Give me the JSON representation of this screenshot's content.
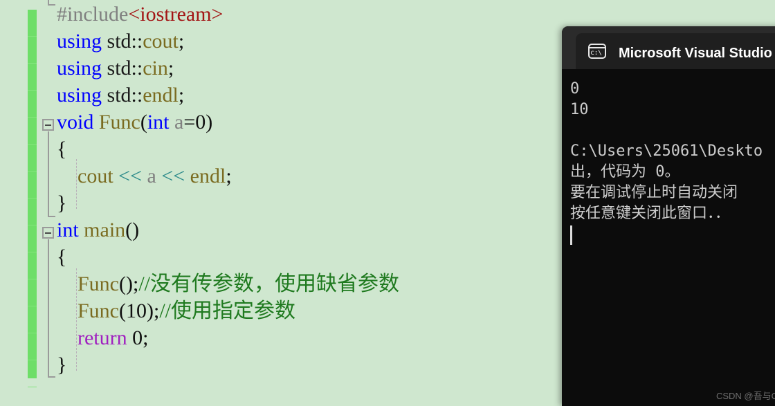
{
  "editor": {
    "background_color": "#cfe7cf",
    "change_bar_color": "#6ede68",
    "lines": [
      {
        "indent": 0,
        "tokens": [
          {
            "t": "#include",
            "c": "pp"
          },
          {
            "t": "<iostream>",
            "c": "hdr"
          }
        ]
      },
      {
        "indent": 0,
        "tokens": [
          {
            "t": "using ",
            "c": "kw"
          },
          {
            "t": "std",
            "c": "ident"
          },
          {
            "t": "::",
            "c": "punct"
          },
          {
            "t": "cout",
            "c": "fn"
          },
          {
            "t": ";",
            "c": "punct"
          }
        ]
      },
      {
        "indent": 0,
        "tokens": [
          {
            "t": "using ",
            "c": "kw"
          },
          {
            "t": "std",
            "c": "ident"
          },
          {
            "t": "::",
            "c": "punct"
          },
          {
            "t": "cin",
            "c": "fn"
          },
          {
            "t": ";",
            "c": "punct"
          }
        ]
      },
      {
        "indent": 0,
        "tokens": [
          {
            "t": "using ",
            "c": "kw"
          },
          {
            "t": "std",
            "c": "ident"
          },
          {
            "t": "::",
            "c": "punct"
          },
          {
            "t": "endl",
            "c": "fn"
          },
          {
            "t": ";",
            "c": "punct"
          }
        ]
      },
      {
        "indent": 0,
        "tokens": [
          {
            "t": "void ",
            "c": "kw"
          },
          {
            "t": "Func",
            "c": "fn"
          },
          {
            "t": "(",
            "c": "punct"
          },
          {
            "t": "int ",
            "c": "kw"
          },
          {
            "t": "a",
            "c": "param"
          },
          {
            "t": "=0)",
            "c": "punct"
          }
        ]
      },
      {
        "indent": 0,
        "tokens": [
          {
            "t": "{",
            "c": "punct"
          }
        ]
      },
      {
        "indent": 0,
        "tokens": [
          {
            "t": "    cout ",
            "c": "fn"
          },
          {
            "t": "<< ",
            "c": "op"
          },
          {
            "t": "a ",
            "c": "param"
          },
          {
            "t": "<< ",
            "c": "op"
          },
          {
            "t": "endl",
            "c": "fn"
          },
          {
            "t": ";",
            "c": "punct"
          }
        ]
      },
      {
        "indent": 0,
        "tokens": [
          {
            "t": "}",
            "c": "punct"
          }
        ]
      },
      {
        "indent": 0,
        "tokens": [
          {
            "t": "int ",
            "c": "kw"
          },
          {
            "t": "main",
            "c": "fn"
          },
          {
            "t": "()",
            "c": "punct"
          }
        ]
      },
      {
        "indent": 0,
        "tokens": [
          {
            "t": "{",
            "c": "punct"
          }
        ]
      },
      {
        "indent": 0,
        "tokens": [
          {
            "t": "    Func",
            "c": "fn"
          },
          {
            "t": "();",
            "c": "punct"
          },
          {
            "t": "//没有传参数，使用缺省参数",
            "c": "cmt"
          }
        ]
      },
      {
        "indent": 0,
        "tokens": [
          {
            "t": "    Func",
            "c": "fn"
          },
          {
            "t": "(10);",
            "c": "punct"
          },
          {
            "t": "//使用指定参数",
            "c": "cmt"
          }
        ]
      },
      {
        "indent": 0,
        "tokens": [
          {
            "t": "    return ",
            "c": "kw2"
          },
          {
            "t": "0;",
            "c": "num"
          }
        ]
      },
      {
        "indent": 0,
        "tokens": [
          {
            "t": "}",
            "c": "punct"
          }
        ]
      }
    ]
  },
  "console": {
    "title": "Microsoft Visual Studio 调试控",
    "icon": "terminal-icon",
    "icon_glyph": "c:\\",
    "background_color": "#0c0c0c",
    "titlebar_color": "#2b2b2b",
    "output_lines": [
      "0",
      "10",
      "",
      "C:\\Users\\25061\\Deskto",
      "出，代码为 0。",
      "要在调试停止时自动关闭",
      "按任意键关闭此窗口．．"
    ]
  },
  "watermark": {
    "text": "CSDN @吾与C"
  }
}
